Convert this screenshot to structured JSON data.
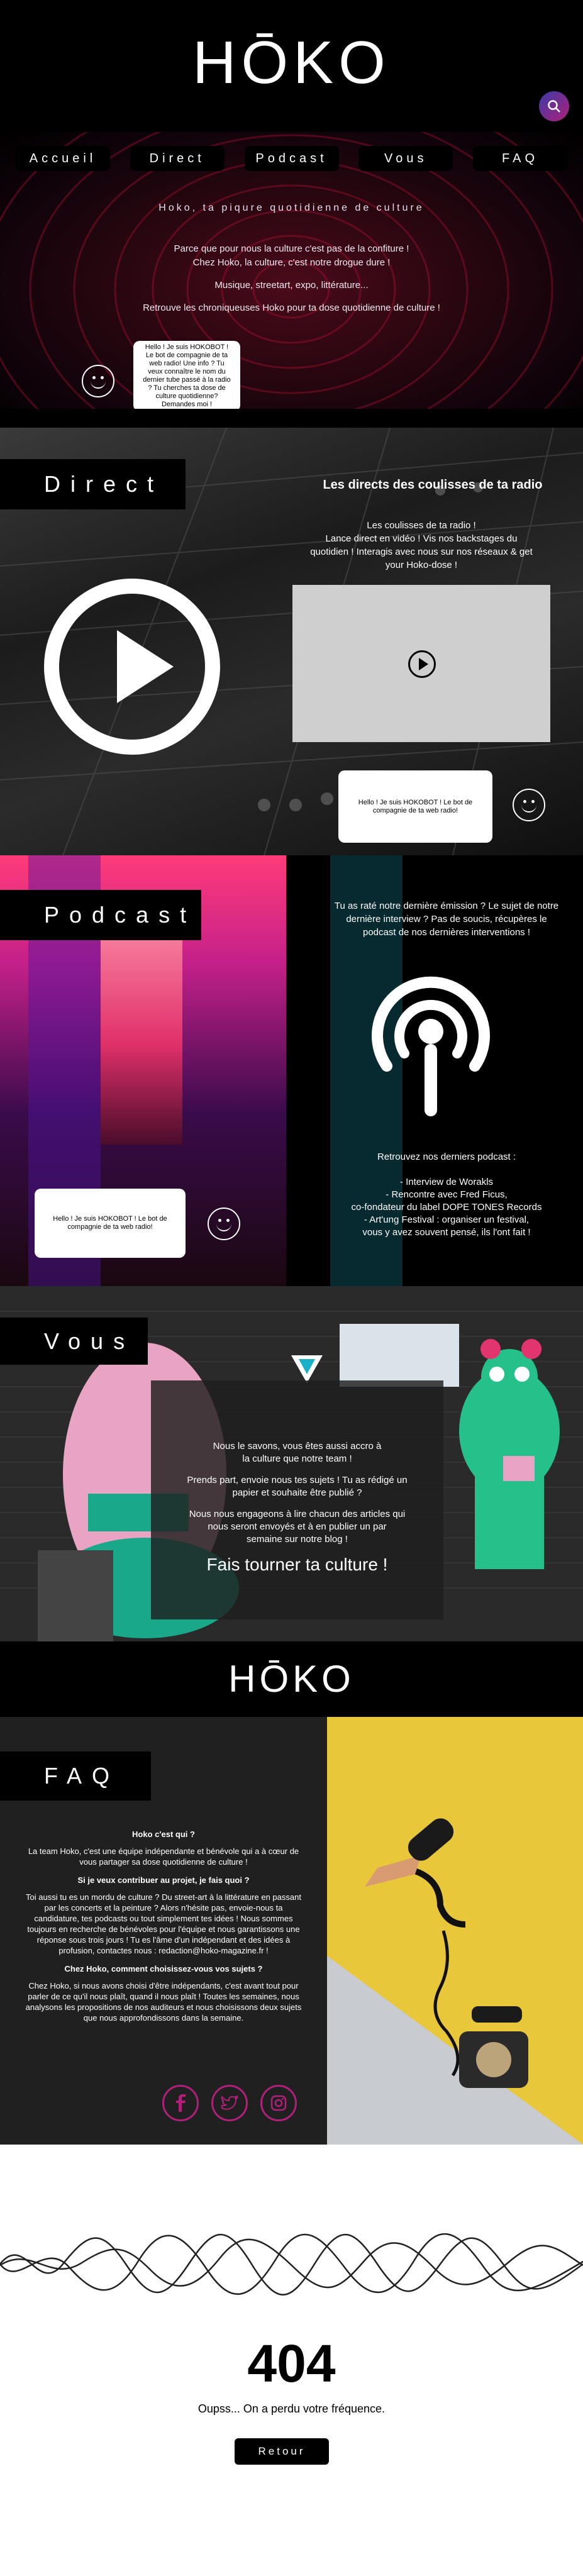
{
  "brand": {
    "logo": "HŌKO",
    "logo_small": "HŌKO"
  },
  "header": {
    "search_icon": "search-icon"
  },
  "nav": {
    "items": [
      "Accueil",
      "Direct",
      "Podcast",
      "Vous",
      "FAQ"
    ]
  },
  "hero": {
    "tagline": "Hoko, ta piqure quotidienne de culture",
    "lines": [
      "Parce que pour nous la culture c'est pas de la confiture !",
      "Chez Hoko, la culture, c'est notre drogue dure !",
      "Musique, streetart, expo, littérature...",
      "Retrouve les chroniqueuses Hoko pour ta dose quotidienne de culture !"
    ],
    "bot": "Hello ! Je suis HOKOBOT ! Le bot de compagnie de ta web radio! Une info ? Tu veux connaître le nom du dernier tube passé à la radio ? Tu cherches ta dose de culture quotidienne? Demandes moi !"
  },
  "direct": {
    "label": "Direct",
    "title": "Les directs des coulisses de ta radio",
    "lines": [
      "Les coulisses de ta radio !",
      "Lance direct en vidéo ! Vis nos backstages du",
      "quotidien ! Interagis avec nous sur nos réseaux & get",
      "your Hoko-dose !"
    ],
    "bot": "Hello ! Je suis HOKOBOT ! Le bot de compagnie de ta web radio!"
  },
  "podcast": {
    "label": "Podcast",
    "intro": "Tu as raté notre dernière émission ? Le sujet de notre dernière interview ? Pas de soucis, récupères le podcast de nos dernières interventions !",
    "latest_title": "Retrouvez nos derniers podcast :",
    "items": [
      "- Interview de Worakls",
      "- Rencontre avec Fred Ficus,",
      "co-fondateur du label DOPE TONES Records",
      "- Art'ung Festival : organiser un festival,",
      "vous y avez souvent pensé, ils l'ont fait !"
    ],
    "bot": "Hello ! Je suis HOKOBOT ! Le bot de compagnie de ta web radio!"
  },
  "vous": {
    "label": "Vous",
    "p1": "Nous le savons, vous êtes aussi accro à la culture que notre team !",
    "p2": "Prends part, envoie nous tes sujets ! Tu as rédigé un papier et souhaite être publié ?",
    "p3": "Nous nous engageons à lire chacun des articles qui nous seront envoyés et à en publier un par semaine sur notre blog !",
    "cta": "Fais tourner ta culture !"
  },
  "faq": {
    "label": "FAQ",
    "q1": "Hoko c'est qui ?",
    "a1": "La team Hoko, c'est une équipe indépendante et bénévole qui a à cœur de vous partager sa dose quotidienne de culture !",
    "q2": "Si je veux contribuer au projet, je fais quoi ?",
    "a2": "Toi aussi tu es un mordu de culture ? Du street-art à la littérature en passant par les concerts et la peinture ? Alors n'hésite pas, envoie-nous ta candidature, tes podcasts ou tout simplement tes idées ! Nous sommes toujours en recherche de bénévoles pour l'équipe et nous garantissons une réponse sous trois jours ! Tu es l'âme d'un indépendant et des idées à profusion, contactes nous : redaction@hoko-magazine.fr !",
    "q3": "Chez Hoko, comment choisissez-vous vos sujets ?",
    "a3": "Chez Hoko, si nous avons choisi d'être indépendants, c'est avant tout pour parler de ce qu'il nous plaît, quand il nous plaît ! Toutes les semaines, nous analysons les propositions de nos auditeurs et nous choisissons deux sujets que nous approfondissons dans la semaine.",
    "socials": [
      "facebook-icon",
      "twitter-icon",
      "instagram-icon"
    ]
  },
  "error": {
    "code": "404",
    "message": "Oupss... On a perdu votre fréquence.",
    "button": "Retour"
  },
  "colors": {
    "accent_pink": "#b0207a",
    "accent_blue": "#3a3aa8",
    "faq_yellow": "#e8c73a"
  }
}
